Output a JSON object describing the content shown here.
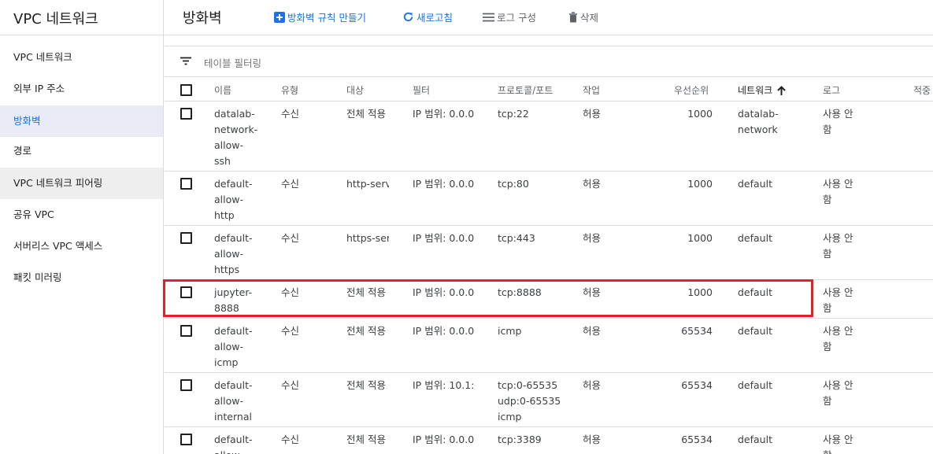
{
  "sidebar": {
    "title": "VPC 네트워크",
    "items": [
      {
        "label": "VPC 네트워크"
      },
      {
        "label": "외부 IP 주소"
      },
      {
        "label": "방화벽"
      },
      {
        "label": "경로"
      },
      {
        "label": "VPC 네트워크 피어링"
      },
      {
        "label": "공유 VPC"
      },
      {
        "label": "서버리스 VPC 액세스"
      },
      {
        "label": "패킷 미러링"
      }
    ]
  },
  "header": {
    "title": "방화벽",
    "create_label": "방화벽 규칙 만들기",
    "refresh_label": "새로고침",
    "logs_label": "로그 구성",
    "delete_label": "삭제"
  },
  "filter": {
    "placeholder": "테이블 필터링"
  },
  "table": {
    "headers": {
      "name": "이름",
      "type": "유형",
      "target": "대상",
      "filter": "필터",
      "protocol": "프로토콜/포트",
      "action": "작업",
      "priority": "우선순위",
      "network": "네트워크",
      "logs": "로그",
      "applied": "적중"
    },
    "rows": [
      {
        "name": [
          "datalab-",
          "network-",
          "allow-",
          "ssh"
        ],
        "type": "수신",
        "target": "전체 적용",
        "filter": "IP 범위: 0.0.0",
        "protocol": [
          "tcp:22"
        ],
        "action": "허용",
        "priority": "1000",
        "network": [
          "datalab-",
          "network"
        ],
        "logs": [
          "사용 안",
          "함"
        ]
      },
      {
        "name": [
          "default-",
          "allow-",
          "http"
        ],
        "type": "수신",
        "target": "http-server",
        "filter": "IP 범위: 0.0.0",
        "protocol": [
          "tcp:80"
        ],
        "action": "허용",
        "priority": "1000",
        "network": [
          "default"
        ],
        "logs": [
          "사용 안",
          "함"
        ]
      },
      {
        "name": [
          "default-",
          "allow-",
          "https"
        ],
        "type": "수신",
        "target": "https-server",
        "filter": "IP 범위: 0.0.0",
        "protocol": [
          "tcp:443"
        ],
        "action": "허용",
        "priority": "1000",
        "network": [
          "default"
        ],
        "logs": [
          "사용 안",
          "함"
        ]
      },
      {
        "name": [
          "jupyter-",
          "8888"
        ],
        "type": "수신",
        "target": "전체 적용",
        "filter": "IP 범위: 0.0.0",
        "protocol": [
          "tcp:8888"
        ],
        "action": "허용",
        "priority": "1000",
        "network": [
          "default"
        ],
        "logs": [
          "사용 안",
          "함"
        ]
      },
      {
        "name": [
          "default-",
          "allow-",
          "icmp"
        ],
        "type": "수신",
        "target": "전체 적용",
        "filter": "IP 범위: 0.0.0",
        "protocol": [
          "icmp"
        ],
        "action": "허용",
        "priority": "65534",
        "network": [
          "default"
        ],
        "logs": [
          "사용 안",
          "함"
        ]
      },
      {
        "name": [
          "default-",
          "allow-",
          "internal"
        ],
        "type": "수신",
        "target": "전체 적용",
        "filter": "IP 범위: 10.1:",
        "protocol": [
          "tcp:0-65535",
          "udp:0-65535",
          "icmp"
        ],
        "action": "허용",
        "priority": "65534",
        "network": [
          "default"
        ],
        "logs": [
          "사용 안",
          "함"
        ]
      },
      {
        "name": [
          "default-",
          "allow-"
        ],
        "type": "수신",
        "target": "전체 적용",
        "filter": "IP 범위: 0.0.0",
        "protocol": [
          "tcp:3389"
        ],
        "action": "허용",
        "priority": "65534",
        "network": [
          "default"
        ],
        "logs": [
          "사용 안",
          "함"
        ]
      }
    ]
  },
  "colors": {
    "accent": "#1a73e8",
    "highlight": "#e4202b",
    "active_bg": "#e8eaf6"
  }
}
